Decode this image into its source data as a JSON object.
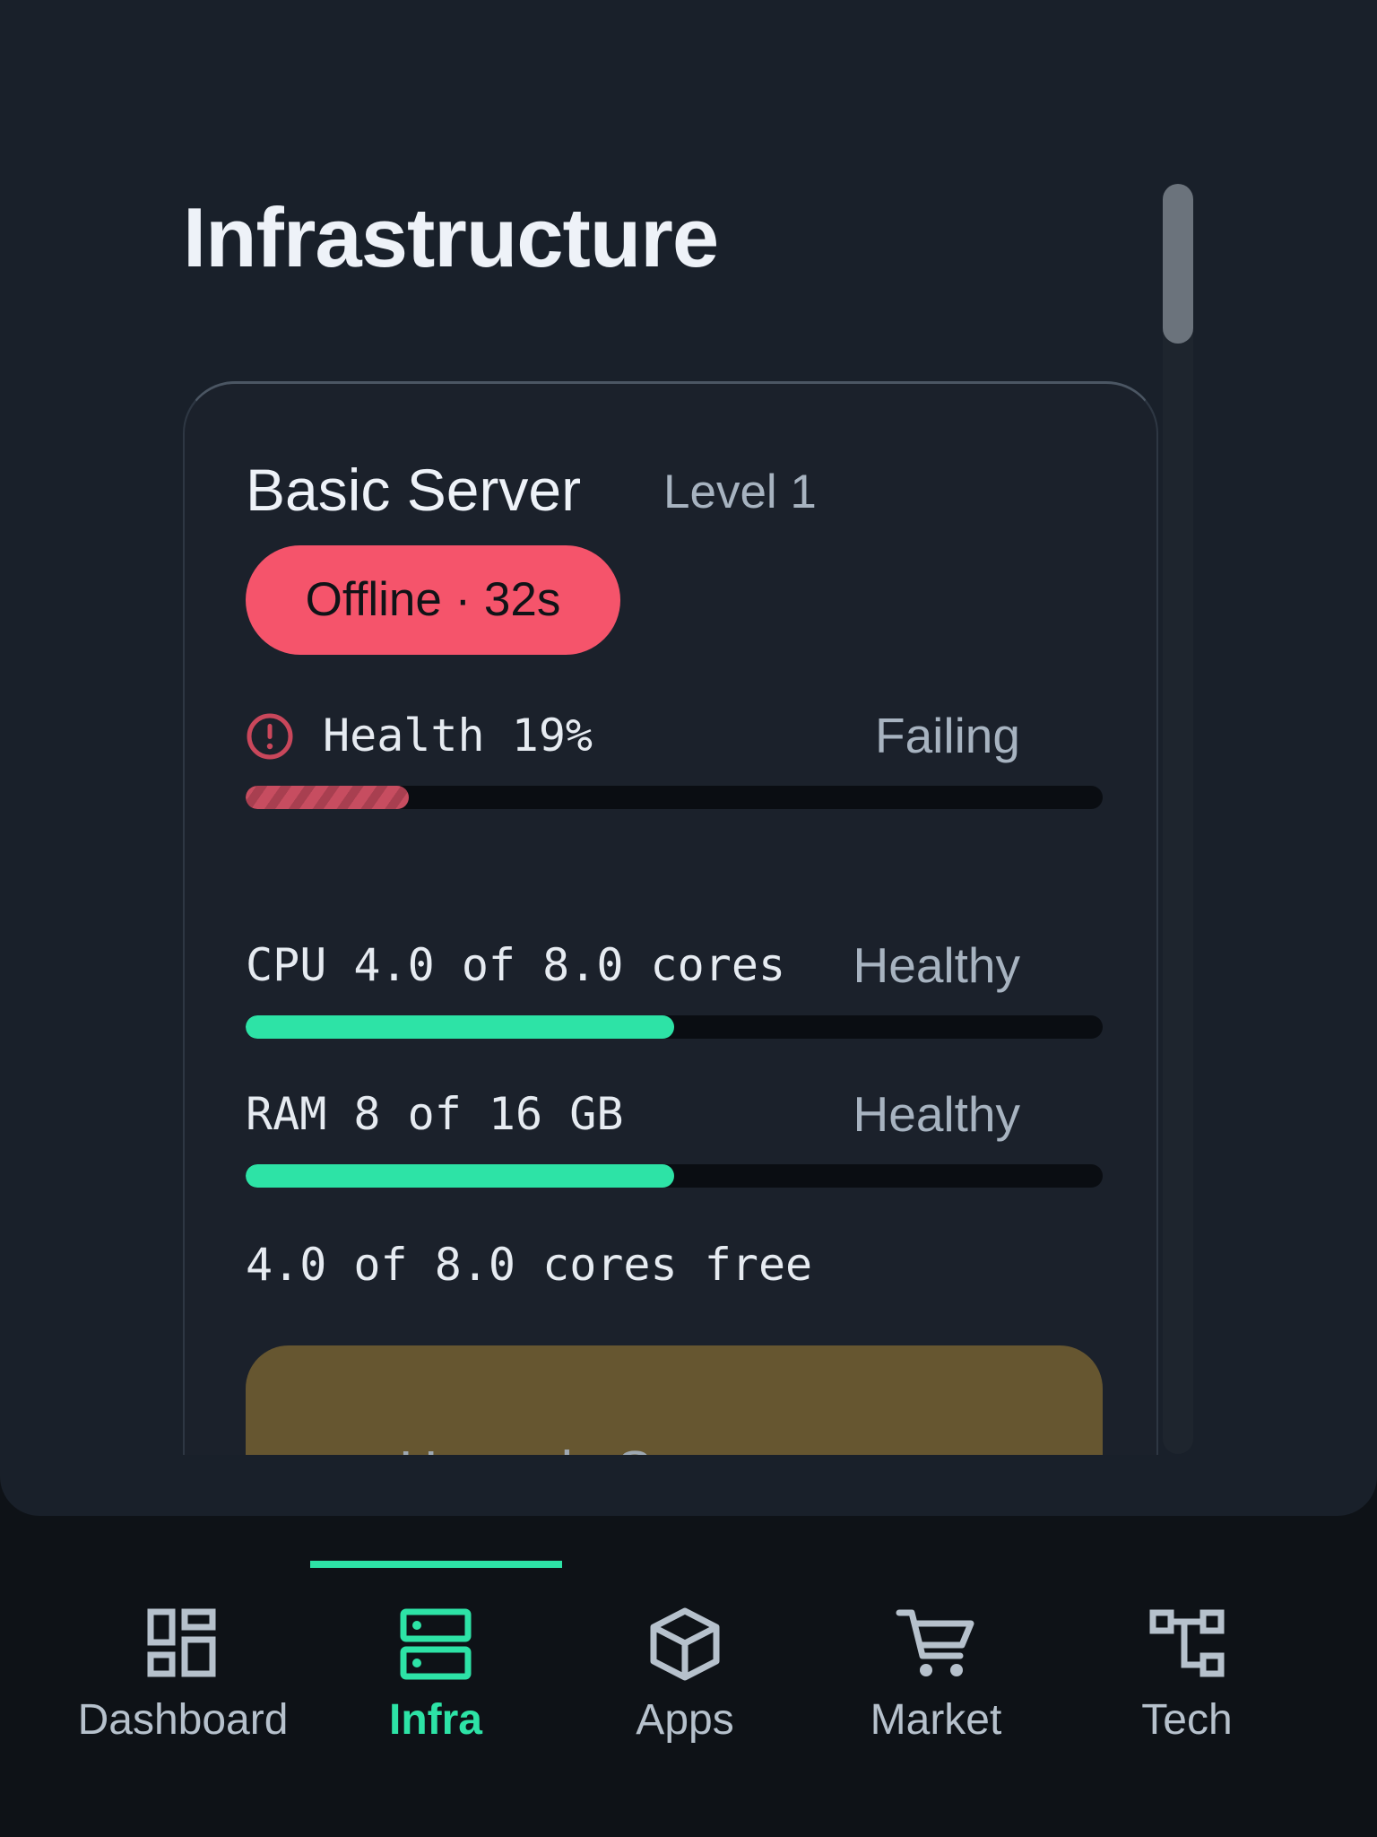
{
  "page": {
    "title": "Infrastructure"
  },
  "server": {
    "name": "Basic Server",
    "level": "Level 1",
    "status": "Offline · 32s"
  },
  "metrics": {
    "health": {
      "label": "Health 19%",
      "state": "Failing",
      "fill_percent": 19,
      "icon": "alert-circle-icon"
    },
    "cpu": {
      "label": "CPU 4.0 of 8.0 cores",
      "state": "Healthy",
      "fill_percent": 50
    },
    "ram": {
      "label": "RAM 8 of 16 GB",
      "state": "Healthy",
      "fill_percent": 50
    },
    "free_note": "4.0 of 8.0 cores free"
  },
  "upgrade": {
    "label": "Upgrade Server · cores"
  },
  "colors": {
    "accent": "#2de3a6",
    "danger": "#f5546b",
    "background": "#19202a",
    "upgrade_button": "#665630"
  },
  "nav": {
    "items": [
      {
        "label": "Dashboard",
        "icon": "dashboard-icon",
        "active": false
      },
      {
        "label": "Infra",
        "icon": "server-icon",
        "active": true
      },
      {
        "label": "Apps",
        "icon": "box-icon",
        "active": false
      },
      {
        "label": "Market",
        "icon": "cart-icon",
        "active": false
      },
      {
        "label": "Tech",
        "icon": "tech-tree-icon",
        "active": false
      }
    ]
  }
}
